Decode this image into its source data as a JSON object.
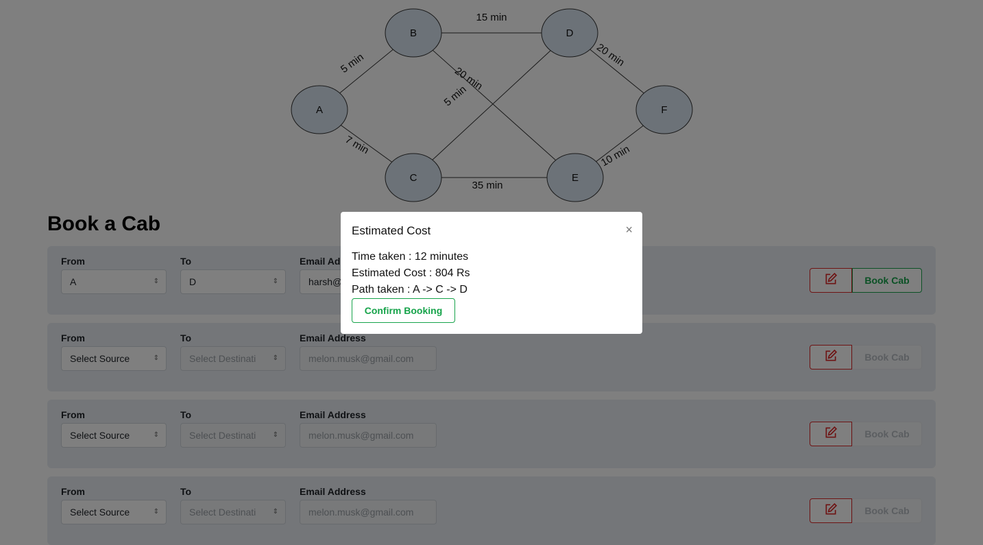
{
  "graph": {
    "nodes": [
      {
        "id": "A",
        "label": "A"
      },
      {
        "id": "B",
        "label": "B"
      },
      {
        "id": "C",
        "label": "C"
      },
      {
        "id": "D",
        "label": "D"
      },
      {
        "id": "E",
        "label": "E"
      },
      {
        "id": "F",
        "label": "F"
      }
    ],
    "edges": [
      {
        "from": "A",
        "to": "B",
        "label": "5 min"
      },
      {
        "from": "A",
        "to": "C",
        "label": "7 min"
      },
      {
        "from": "B",
        "to": "D",
        "label": "15 min"
      },
      {
        "from": "B",
        "to": "E",
        "label": "20 min"
      },
      {
        "from": "C",
        "to": "D",
        "label": "5 min"
      },
      {
        "from": "C",
        "to": "E",
        "label": "35 min"
      },
      {
        "from": "D",
        "to": "F",
        "label": "20 min"
      },
      {
        "from": "E",
        "to": "F",
        "label": "10 min"
      }
    ],
    "node_fill": "#d8e4f0"
  },
  "page": {
    "title": "Book a Cab"
  },
  "labels": {
    "from": "From",
    "to": "To",
    "email": "Email Address",
    "book": "Book Cab"
  },
  "rows": [
    {
      "from": "A",
      "to": "D",
      "email": "harsh@",
      "email_placeholder": false,
      "to_disabled": false,
      "book_active": true
    },
    {
      "from": "Select Source",
      "to": "Select Destinati",
      "email": "melon.musk@gmail.com",
      "email_placeholder": true,
      "to_disabled": true,
      "book_active": false
    },
    {
      "from": "Select Source",
      "to": "Select Destinati",
      "email": "melon.musk@gmail.com",
      "email_placeholder": true,
      "to_disabled": true,
      "book_active": false
    },
    {
      "from": "Select Source",
      "to": "Select Destinati",
      "email": "melon.musk@gmail.com",
      "email_placeholder": true,
      "to_disabled": true,
      "book_active": false
    }
  ],
  "modal": {
    "title": "Estimated Cost",
    "close": "×",
    "time": "Time taken : 12 minutes",
    "cost": "Estimated Cost : 804 Rs",
    "path": "Path taken : A -> C -> D",
    "confirm": "Confirm Booking"
  },
  "colors": {
    "accent_green": "#16a34a",
    "danger_red": "#dc2626"
  }
}
